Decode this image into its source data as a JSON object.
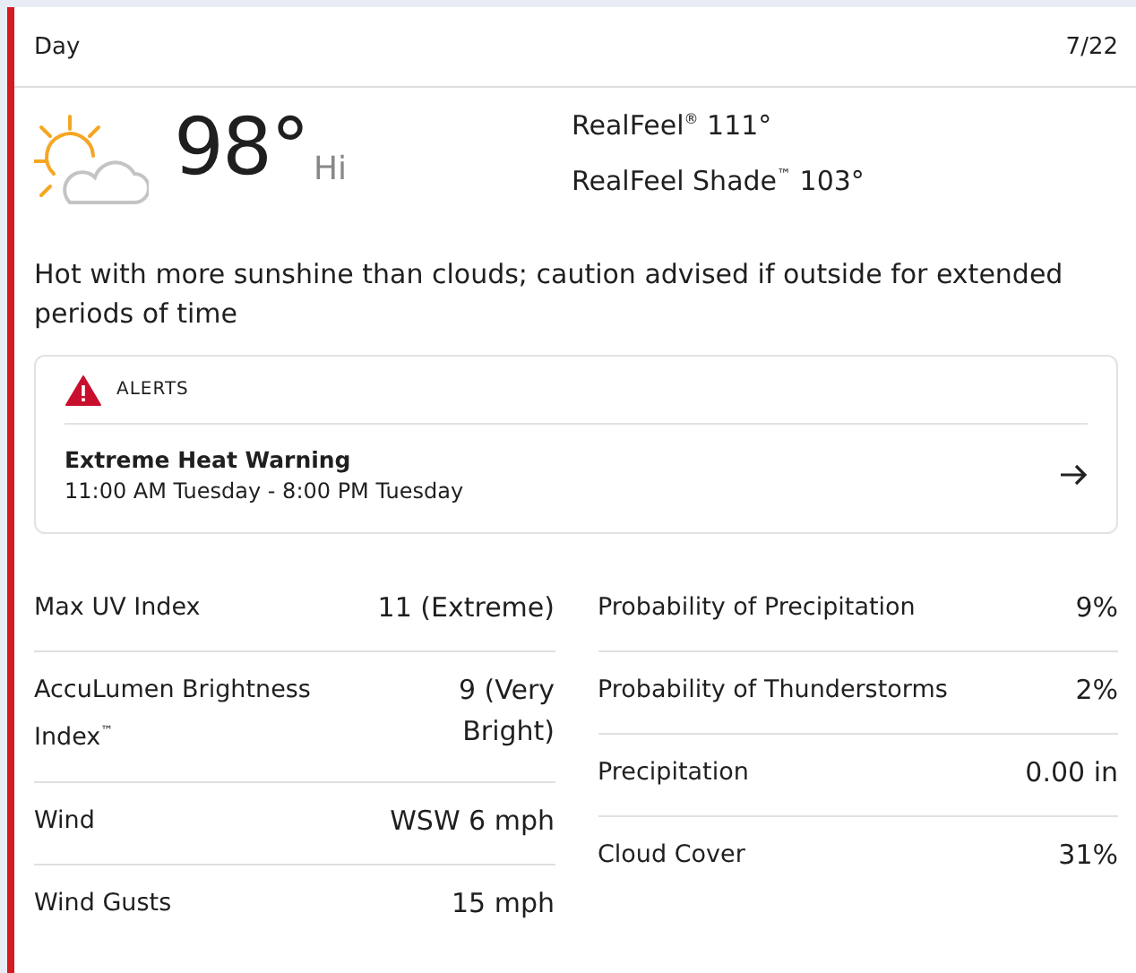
{
  "header": {
    "title": "Day",
    "date": "7/22"
  },
  "current": {
    "temperature": "98°",
    "label": "Hi",
    "realfeel": "RealFeel$^{®}$ 111°",
    "realfeel_shade": "RealFeel Shade$^{™}$ 103°"
  },
  "phrase": "Hot with more sunshine than clouds; caution advised if outside for extended periods of time",
  "alerts": {
    "heading": "ALERTS",
    "items": [
      {
        "title": "Extreme Heat Warning",
        "time": "11:00 AM Tuesday - 8:00 PM Tuesday"
      }
    ]
  },
  "details_left": [
    {
      "label": "Max UV Index",
      "value": "11 (Extreme)"
    },
    {
      "label": "AccuLumen Brightness Index$^{™}$",
      "value": "9 (Very Bright)"
    },
    {
      "label": "Wind",
      "value": "WSW 6 mph"
    },
    {
      "label": "Wind Gusts",
      "value": "15 mph"
    }
  ],
  "details_right": [
    {
      "label": "Probability of Precipitation",
      "value": "9%"
    },
    {
      "label": "Probability of Thunderstorms",
      "value": "2%"
    },
    {
      "label": "Precipitation",
      "value": "0.00 in"
    },
    {
      "label": "Cloud Cover",
      "value": "31%"
    }
  ]
}
